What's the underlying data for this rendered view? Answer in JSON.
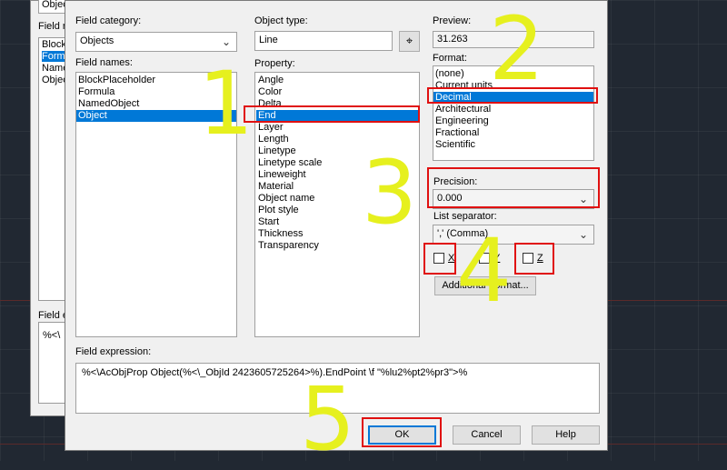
{
  "background_dialog": {
    "top_text": "Objec",
    "field_label": "Field n",
    "list_items": [
      "Block",
      "Formu",
      "Name",
      "Objec"
    ],
    "expr_label": "Field e",
    "expr_text": "%<\\"
  },
  "dialog": {
    "field_category_label": "Field category:",
    "field_category_value": "Objects",
    "field_names_label": "Field names:",
    "field_names": [
      "BlockPlaceholder",
      "Formula",
      "NamedObject",
      "Object"
    ],
    "field_names_selected_index": 3,
    "object_type_label": "Object type:",
    "object_type_value": "Line",
    "property_label": "Property:",
    "properties": [
      "Angle",
      "Color",
      "Delta",
      "End",
      "Layer",
      "Length",
      "Linetype",
      "Linetype scale",
      "Lineweight",
      "Material",
      "Object name",
      "Plot style",
      "Start",
      "Thickness",
      "Transparency"
    ],
    "property_selected_index": 3,
    "preview_label": "Preview:",
    "preview_value": "31.263",
    "format_label": "Format:",
    "formats": [
      "(none)",
      "Current units",
      "Decimal",
      "Architectural",
      "Engineering",
      "Fractional",
      "Scientific"
    ],
    "format_selected_index": 2,
    "precision_label": "Precision:",
    "precision_value": "0.000",
    "list_separator_label": "List separator:",
    "list_separator_value": "',' (Comma)",
    "checkbox_x_label": "X",
    "checkbox_y_label": "Y",
    "checkbox_z_label": "Z",
    "additional_format_button": "Additional Format...",
    "field_expression_label": "Field expression:",
    "field_expression_value": "%<\\AcObjProp Object(%<\\_ObjId 2423605725264>%).EndPoint \\f \"%lu2%pt2%pr3\">%",
    "ok_button": "OK",
    "cancel_button": "Cancel",
    "help_button": "Help"
  },
  "annotations": {
    "step1": "1",
    "step2": "2",
    "step3": "3",
    "step4": "4",
    "step5": "5",
    "annotation_color": "#e6f01e",
    "highlight_color": "#e01010"
  },
  "colors": {
    "selection": "#0078d7",
    "canvas": "#212832",
    "dialog": "#f0f0f0"
  }
}
